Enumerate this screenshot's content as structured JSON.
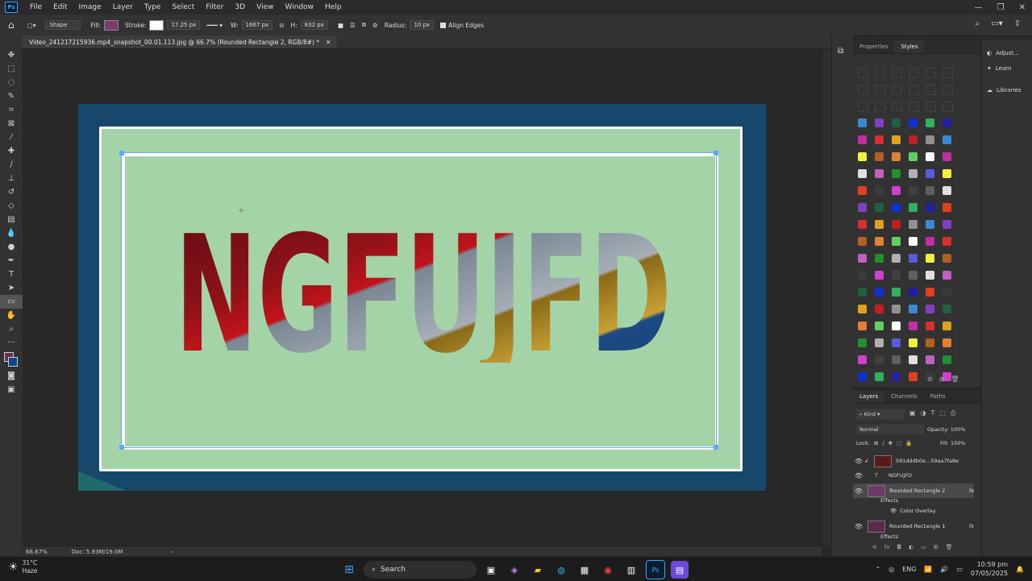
{
  "menubar": {
    "logo": "Ps",
    "items": [
      "File",
      "Edit",
      "Image",
      "Layer",
      "Type",
      "Select",
      "Filter",
      "3D",
      "View",
      "Window",
      "Help"
    ]
  },
  "options": {
    "mode": "Shape",
    "fill_label": "Fill:",
    "fill_color": "#7b3b6b",
    "stroke_label": "Stroke:",
    "stroke_width": "17.25 px",
    "w_label": "W:",
    "w_value": "1667 px",
    "h_label": "H:",
    "h_value": "832 px",
    "radius_label": "Radius:",
    "radius_value": "10 px",
    "align_edges": "Align Edges"
  },
  "document": {
    "tab_title": "Video_241217215936.mp4_snapshot_00.01.113.jpg @ 66.7% (Rounded Rectangle 2, RGB/8#) *",
    "big_text": "NGFUJFD",
    "zoom": "66.67%",
    "doc_size": "Doc: 5.93M/19.0M"
  },
  "panels": {
    "top_tabs": [
      "Properties",
      "Styles"
    ],
    "right_column": [
      "Adjust...",
      "Learn",
      "Libraries"
    ],
    "layers_tabs": [
      "Layers",
      "Channels",
      "Paths"
    ],
    "kind": "Kind",
    "blend_mode": "Normal",
    "opacity_label": "Opacity:",
    "opacity_value": "100%",
    "lock_label": "Lock:",
    "fill_label": "Fill:",
    "fill_value": "100%",
    "layers": [
      {
        "name": "591dddb0e...59aa7fa8e"
      },
      {
        "name": "NGFUJFD"
      },
      {
        "name": "Rounded Rectangle 2"
      },
      {
        "name": "Effects"
      },
      {
        "name": "Color Overlay"
      },
      {
        "name": "Rounded Rectangle 1"
      },
      {
        "name": "Effects"
      }
    ]
  },
  "taskbar": {
    "weather_temp": "31°C",
    "weather_text": "Haze",
    "search": "Search",
    "lang": "ENG",
    "time": "10:59 pm",
    "date": "07/05/2025"
  },
  "colors": {
    "canvas_green": "#a3d3a6",
    "doc_blue": "#17476a",
    "selection_blue": "#5fa8ff"
  }
}
